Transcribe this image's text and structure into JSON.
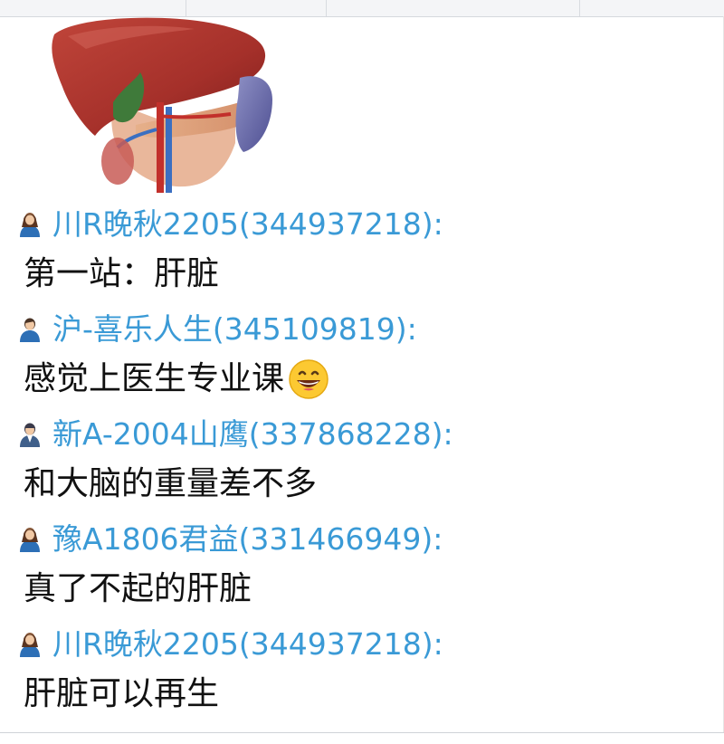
{
  "image": {
    "alt": "",
    "icon": "liver-anatomy-illustration"
  },
  "colors": {
    "sender": "#3a9ad6",
    "message_text": "#111111",
    "background": "#ffffff"
  },
  "messages": [
    {
      "sender": "川R晚秋2205(344937218):",
      "avatar": "female-user-icon",
      "text": "第一站：肝脏",
      "emoji": ""
    },
    {
      "sender": "沪-喜乐人生(345109819):",
      "avatar": "male-user-icon",
      "text": "感觉上医生专业课",
      "emoji": "grinning-face-icon"
    },
    {
      "sender": "新A-2004山鹰(337868228):",
      "avatar": "user-icon",
      "text": "和大脑的重量差不多",
      "emoji": ""
    },
    {
      "sender": "豫A1806君益(331466949):",
      "avatar": "female-user-icon",
      "text": "真了不起的肝脏",
      "emoji": ""
    },
    {
      "sender": "川R晚秋2205(344937218):",
      "avatar": "female-user-icon",
      "text": "肝脏可以再生",
      "emoji": ""
    }
  ]
}
